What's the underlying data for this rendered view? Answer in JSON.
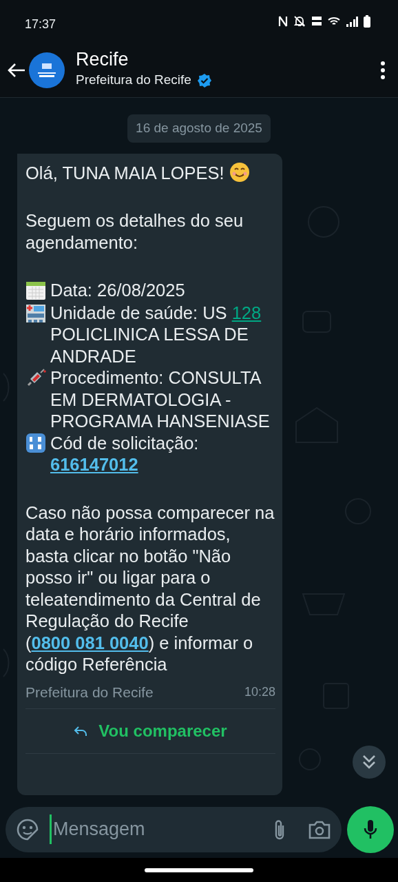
{
  "status_bar": {
    "time": "17:37"
  },
  "header": {
    "title": "Recife",
    "subtitle": "Prefeitura do Recife",
    "verified": true
  },
  "date_chip": "16 de agosto de 2025",
  "message": {
    "greeting": "Olá, TUNA MAIA LOPES!",
    "intro": "Seguem os detalhes do seu agendamento:",
    "details": [
      {
        "kind": "date",
        "text": "Data: 26/08/2025"
      },
      {
        "kind": "unit",
        "text": "Unidade de saúde: US ",
        "link": "128",
        "after": " POLICLINICA LESSA DE ANDRADE"
      },
      {
        "kind": "procedure",
        "text": "Procedimento: CONSULTA EM DERMATOLOGIA - PROGRAMA HANSENIASE"
      },
      {
        "kind": "code",
        "text": "Cód de solicitação:",
        "link": "616147012"
      }
    ],
    "notice": {
      "text": "Caso não possa comparecer na data e horário informados, basta clicar no botão \"Não posso ir\" ou ligar para o teleatendimento da Central de Regulação do Recife (",
      "link": "0800 081 0040",
      "after": ") e informar o código Referência"
    },
    "footer": "Prefeitura do Recife",
    "time": "10:28",
    "reply_button": "Vou comparecer"
  },
  "composer": {
    "placeholder": "Mensagem"
  }
}
